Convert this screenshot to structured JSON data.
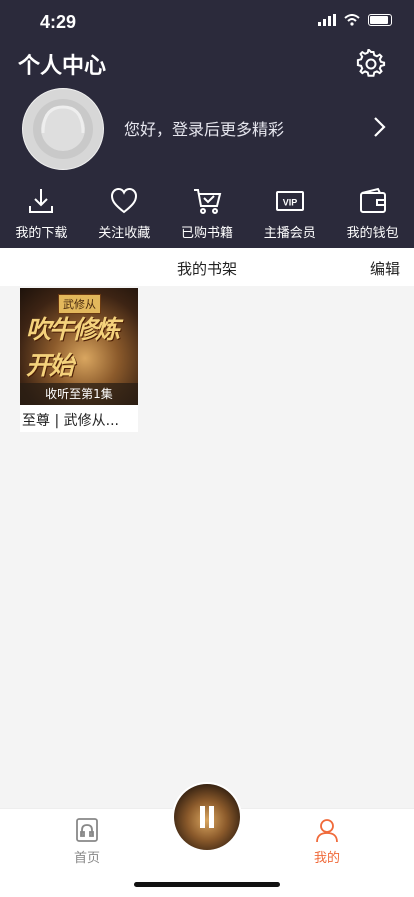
{
  "status_bar": {
    "time": "4:29"
  },
  "header": {
    "title": "个人中心",
    "login_prompt": "您好，登录后更多精彩",
    "quick_links": [
      {
        "label": "我的下载",
        "icon": "download-icon"
      },
      {
        "label": "关注收藏",
        "icon": "heart-icon"
      },
      {
        "label": "已购书籍",
        "icon": "cart-icon"
      },
      {
        "label": "主播会员",
        "icon": "vip-icon"
      },
      {
        "label": "我的钱包",
        "icon": "wallet-icon"
      }
    ],
    "vip_badge": "VIP"
  },
  "shelf": {
    "title": "我的书架",
    "edit_label": "编辑",
    "books": [
      {
        "cover_tag": "武修从",
        "cover_text": "吹牛修炼开始",
        "progress": "收听至第1集",
        "name": "至尊 | 武修从..."
      }
    ]
  },
  "tabbar": {
    "home_label": "首页",
    "mine_label": "我的"
  },
  "colors": {
    "header_bg": "#2b2a3b",
    "active_tab": "#f06a3a"
  }
}
